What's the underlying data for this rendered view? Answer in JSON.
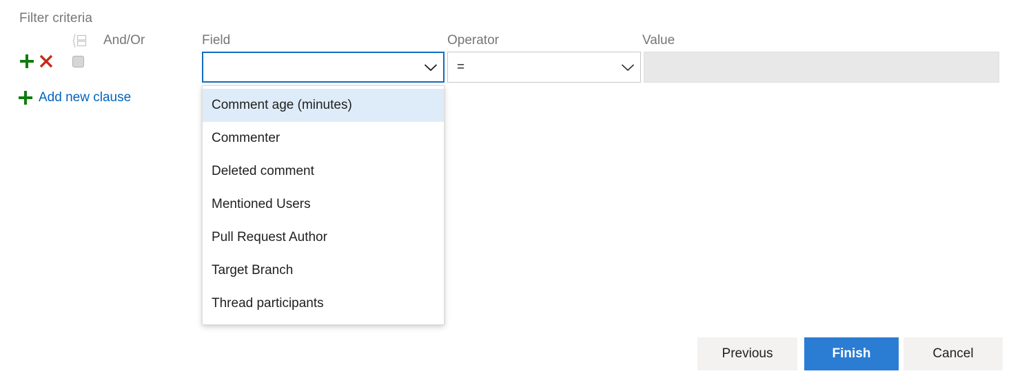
{
  "section": {
    "title": "Filter criteria"
  },
  "columns": {
    "group_icon": "group-clause-icon",
    "andor": "And/Or",
    "field": "Field",
    "operator": "Operator",
    "value": "Value"
  },
  "clause_row": {
    "add_icon": "plus-icon",
    "delete_icon": "close-x-icon",
    "group_checkbox_checked": false,
    "field_value": "",
    "field_chevron": "chevron-down-icon",
    "operator_value": "=",
    "operator_chevron": "chevron-down-icon",
    "value_value": "",
    "value_placeholder": "",
    "value_disabled": true
  },
  "add_clause": {
    "icon": "plus-icon",
    "label": "Add new clause"
  },
  "field_dropdown": {
    "open": true,
    "selected_index": 0,
    "items": [
      "Comment age (minutes)",
      "Commenter",
      "Deleted comment",
      "Mentioned Users",
      "Pull Request Author",
      "Target Branch",
      "Thread participants"
    ]
  },
  "footer": {
    "previous_label": "Previous",
    "finish_label": "Finish",
    "cancel_label": "Cancel"
  },
  "colors": {
    "accent_blue": "#2b7cd3",
    "focus_border": "#0f6cbd",
    "link_blue": "#0064bf",
    "plus_green": "#107c10",
    "delete_red": "#c42b1c",
    "label_gray": "#767676",
    "highlight": "#deecf9",
    "disabled_bg": "#e8e8e8"
  }
}
